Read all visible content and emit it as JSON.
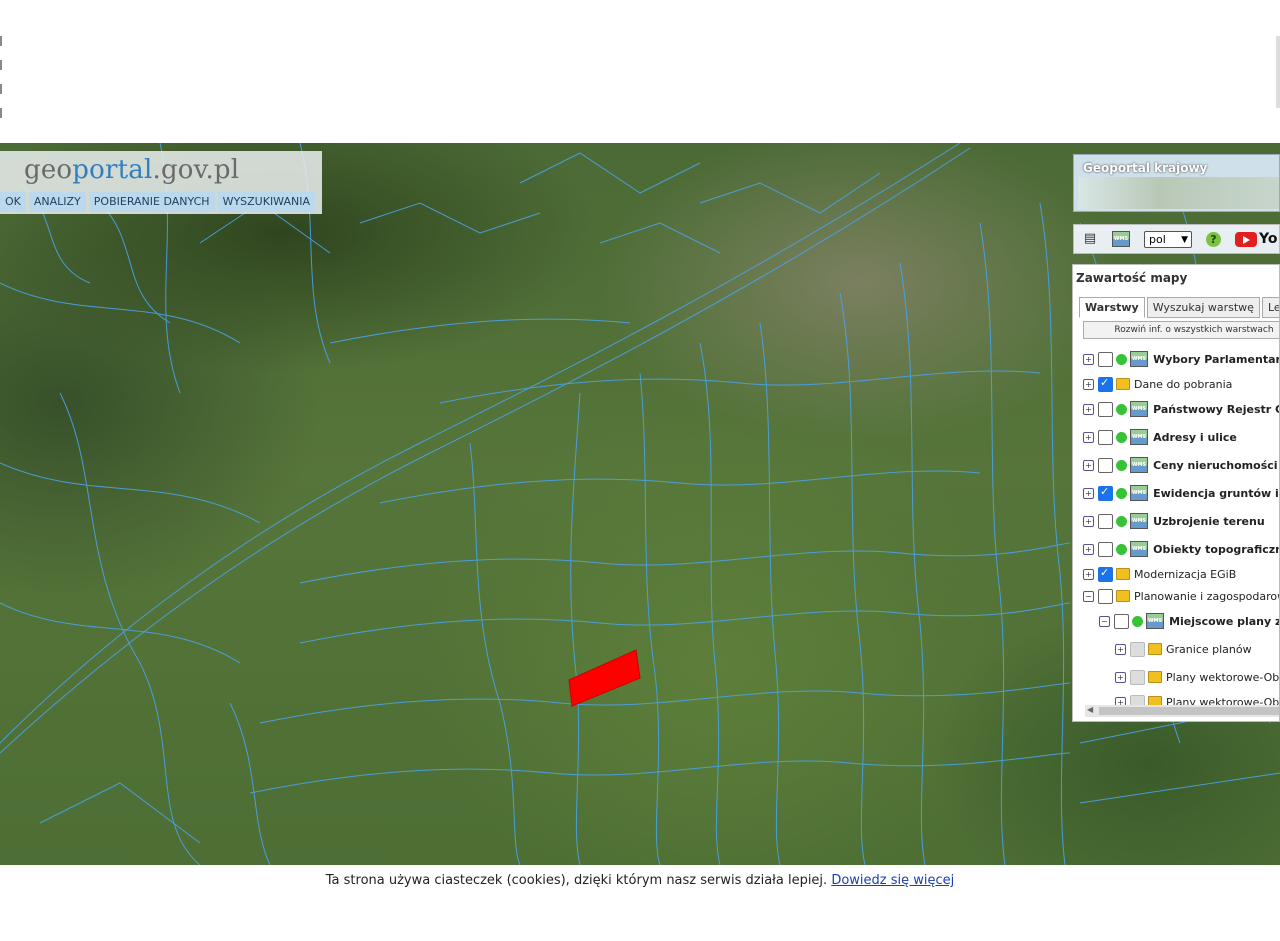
{
  "logo": {
    "part1": "geo",
    "part2": "portal",
    "part3": ".gov.pl"
  },
  "menu": [
    "OK",
    "ANALIZY",
    "POBIERANIE DANYCH",
    "WYSZUKIWANIA"
  ],
  "geoportal_box": {
    "title": "Geoportal krajowy"
  },
  "toolbar": {
    "lang": "pol",
    "youtube_text": "Yo"
  },
  "panel": {
    "title": "Zawartość mapy",
    "tabs": [
      "Warstwy",
      "Wyszukaj warstwę",
      "Lege"
    ],
    "expand_label": "Rozwiń inf. o wszystkich warstwach",
    "layers": [
      {
        "label": "Wybory Parlamentarne",
        "checked": false,
        "bold": true
      },
      {
        "label": "Dane do pobrania",
        "checked": true,
        "bold": false
      },
      {
        "label": "Państwowy Rejestr Gra",
        "checked": false,
        "bold": true
      },
      {
        "label": "Adresy i ulice",
        "checked": false,
        "bold": true
      },
      {
        "label": "Ceny nieruchomości",
        "checked": false,
        "bold": true
      },
      {
        "label": "Ewidencja gruntów i bu",
        "checked": true,
        "bold": true
      },
      {
        "label": "Uzbrojenie terenu",
        "checked": false,
        "bold": true
      },
      {
        "label": "Obiekty topograficzne",
        "checked": false,
        "bold": true
      },
      {
        "label": "Modernizacja EGiB",
        "checked": true,
        "bold": false
      },
      {
        "label": "Planowanie i zagospodarowan",
        "checked": false,
        "bold": false
      },
      {
        "label": "Miejscowe plany zag",
        "checked": false,
        "bold": true
      },
      {
        "label": "Granice planów",
        "checked": false,
        "bold": false
      },
      {
        "label": "Plany wektorowe-Obie",
        "checked": false,
        "bold": false
      },
      {
        "label": "Plany wektorowe-Obie",
        "checked": false,
        "bold": false
      }
    ]
  },
  "cookie": {
    "text": "Ta strona używa ciasteczek (cookies), dzięki którym nasz serwis działa lepiej. ",
    "link": "Dowiedz się więcej"
  },
  "colors": {
    "parcel_lines": "#4aa3e8",
    "highlight": "#ff0000",
    "menu_bg": "#bcd8ec"
  }
}
